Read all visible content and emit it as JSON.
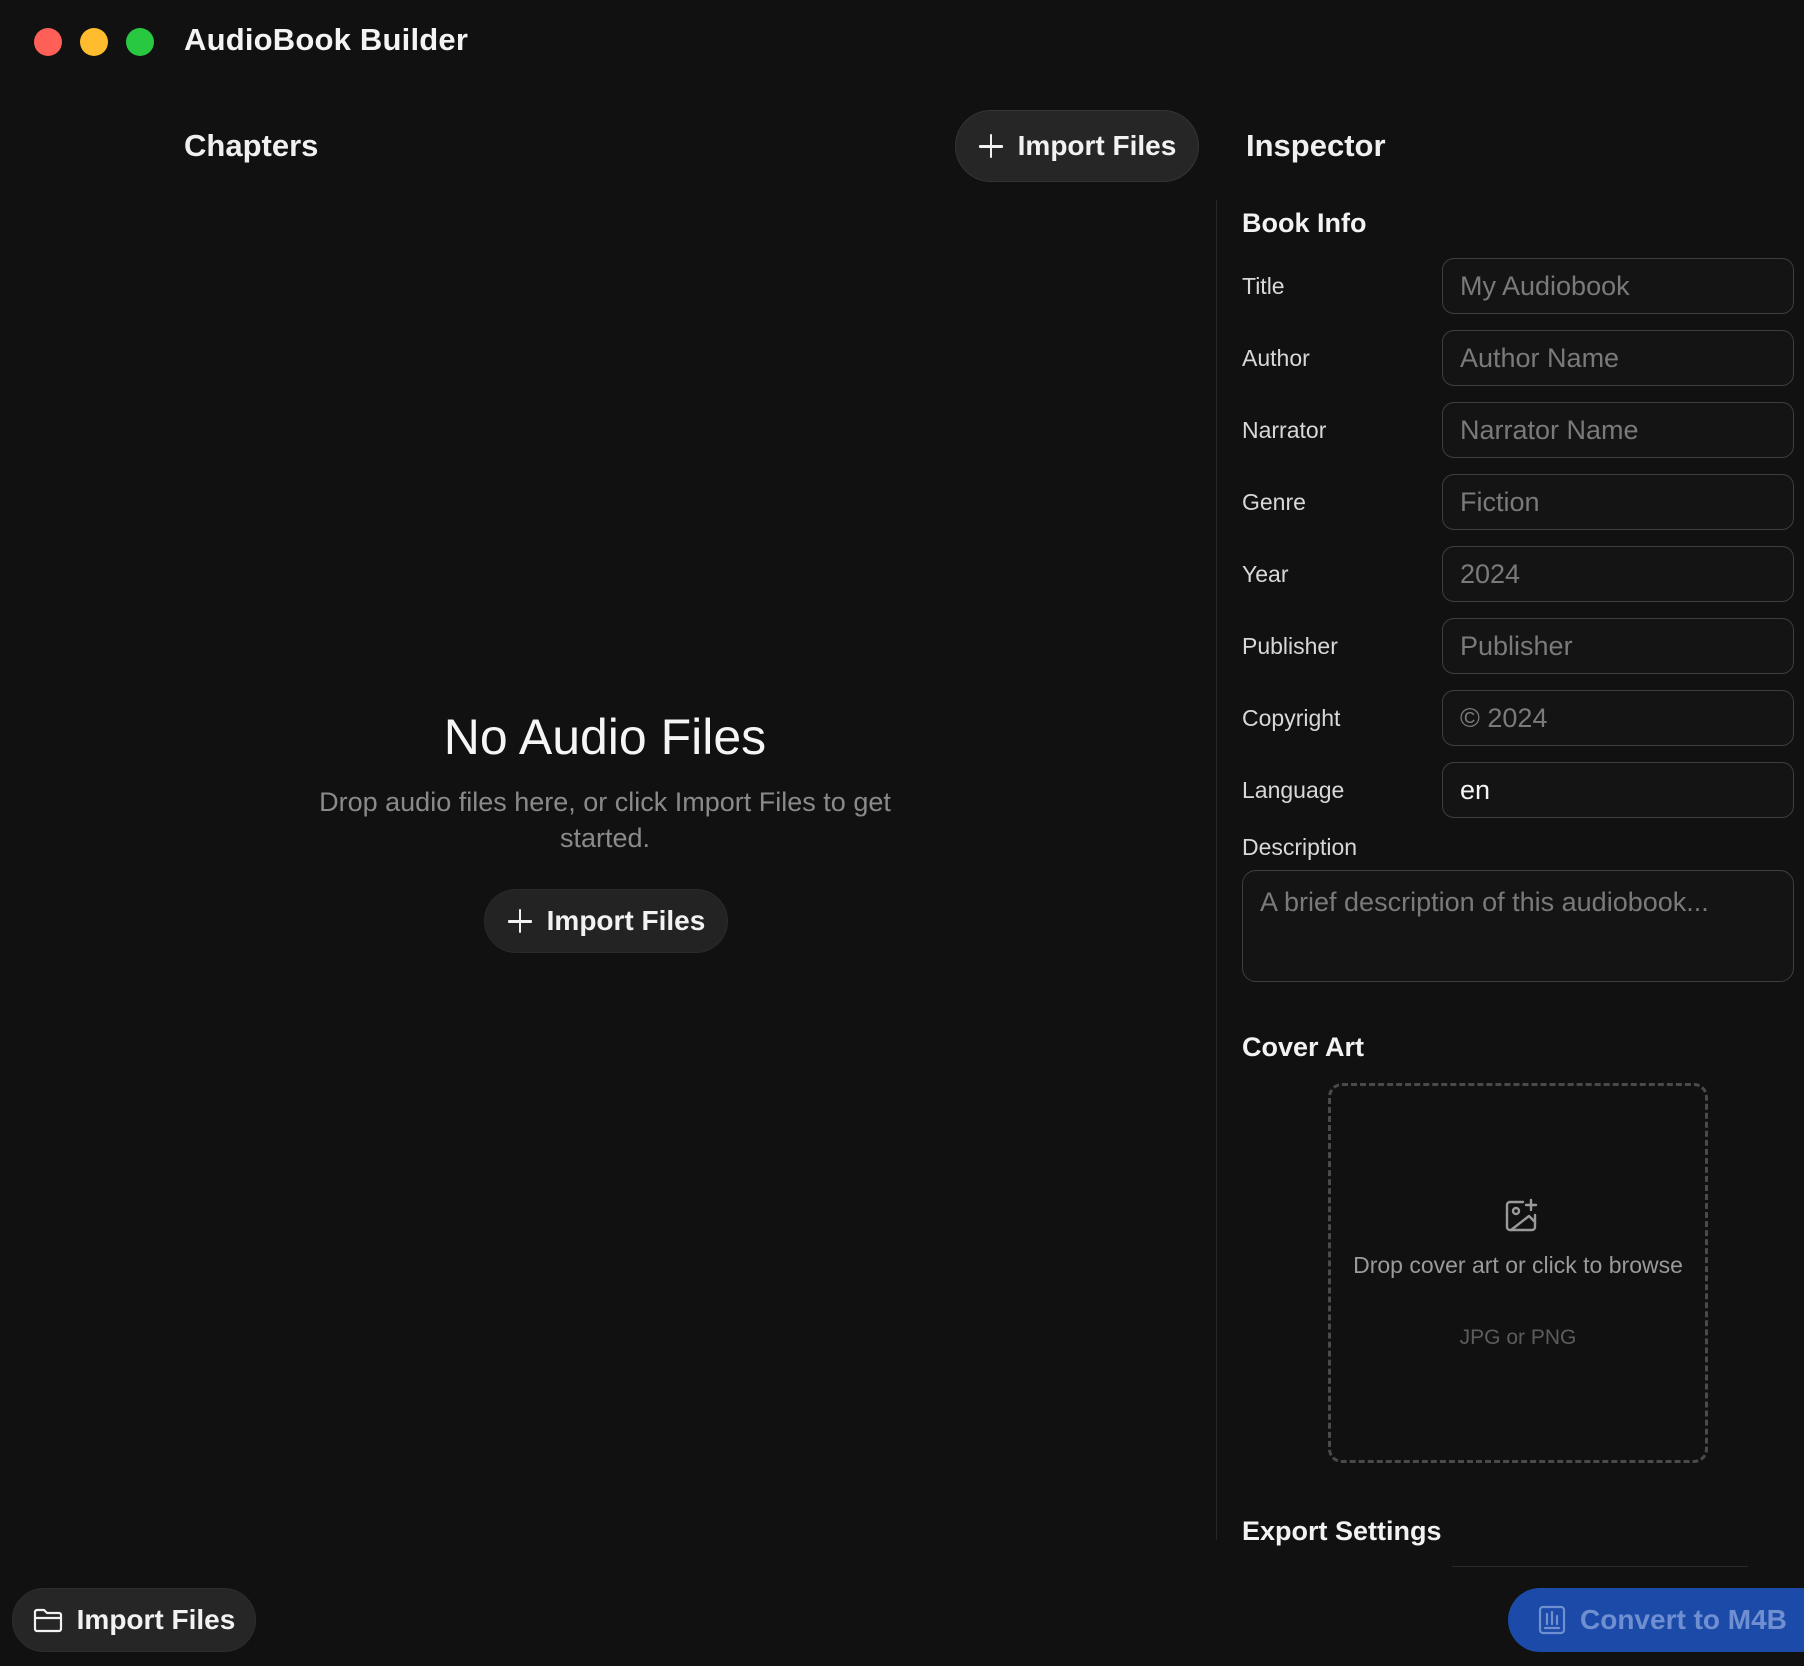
{
  "window": {
    "title": "AudioBook Builder",
    "traffic_lights": [
      "close",
      "minimize",
      "maximize"
    ]
  },
  "chapters": {
    "title": "Chapters",
    "import_button_label": "Import Files",
    "empty_state": {
      "title": "No Audio Files",
      "subtitle": "Drop audio files here, or click Import Files to get started.",
      "button_label": "Import Files"
    }
  },
  "inspector": {
    "title": "Inspector",
    "book_info": {
      "section_title": "Book Info",
      "fields": [
        {
          "label": "Title",
          "value": "",
          "placeholder": "My Audiobook"
        },
        {
          "label": "Author",
          "value": "",
          "placeholder": "Author Name"
        },
        {
          "label": "Narrator",
          "value": "",
          "placeholder": "Narrator Name"
        },
        {
          "label": "Genre",
          "value": "",
          "placeholder": "Fiction"
        },
        {
          "label": "Year",
          "value": "",
          "placeholder": "2024"
        },
        {
          "label": "Publisher",
          "value": "",
          "placeholder": "Publisher"
        },
        {
          "label": "Copyright",
          "value": "",
          "placeholder": "© 2024"
        },
        {
          "label": "Language",
          "value": "en",
          "placeholder": ""
        }
      ],
      "description": {
        "label": "Description",
        "placeholder": "A brief description of this audiobook..."
      }
    },
    "cover_art": {
      "section_title": "Cover Art",
      "drop_text": "Drop cover art or click to browse",
      "formats": "JPG or PNG",
      "icon": "image-add-icon"
    },
    "export_settings": {
      "section_title": "Export Settings"
    }
  },
  "bottom_bar": {
    "import_label": "Import Files",
    "import_icon": "folder-icon",
    "convert_label": "Convert to M4B",
    "convert_icon": "m4b-icon"
  },
  "colors": {
    "background": "#111111",
    "accent": "#1c4aa8",
    "close": "#fe5f57",
    "minimize": "#febc2e",
    "maximize": "#28c840"
  }
}
